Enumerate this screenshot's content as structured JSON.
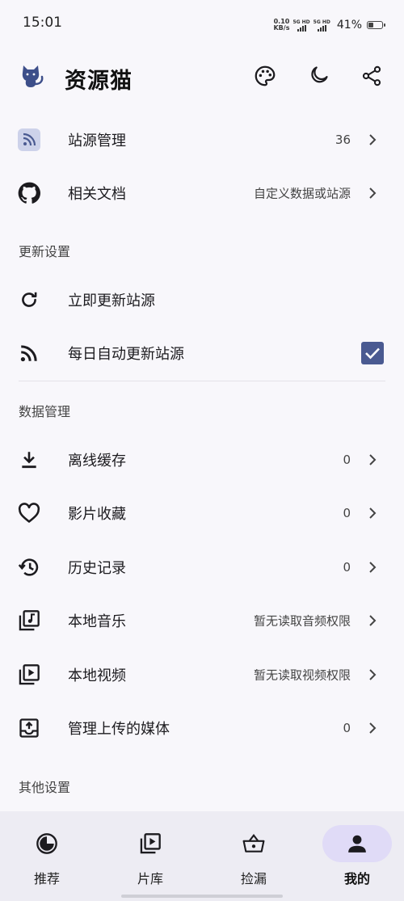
{
  "status_bar": {
    "time": "15:01",
    "net_speed_value": "0.10",
    "net_speed_unit": "KB/s",
    "sim1_label": "5G HD",
    "sim2_label": "5G HD",
    "battery_percent": "41%",
    "battery_level": 0.41
  },
  "app_bar": {
    "title": "资源猫",
    "actions": [
      "palette-icon",
      "dark-mode-icon",
      "share-icon"
    ]
  },
  "rows": {
    "source_manage": {
      "label": "站源管理",
      "value": "36",
      "icon": "rss-icon"
    },
    "docs": {
      "label": "相关文档",
      "value": "自定义数据或站源",
      "icon": "github-icon"
    }
  },
  "sections": {
    "update": {
      "header": "更新设置",
      "update_now": {
        "label": "立即更新站源",
        "icon": "refresh-icon"
      },
      "auto_update": {
        "label": "每日自动更新站源",
        "icon": "rss-icon",
        "checked": true
      }
    },
    "data": {
      "header": "数据管理",
      "offline_cache": {
        "label": "离线缓存",
        "value": "0",
        "icon": "download-icon"
      },
      "favorites": {
        "label": "影片收藏",
        "value": "0",
        "icon": "heart-icon"
      },
      "history": {
        "label": "历史记录",
        "value": "0",
        "icon": "history-icon"
      },
      "local_music": {
        "label": "本地音乐",
        "value": "暂无读取音频权限",
        "icon": "music-library-icon"
      },
      "local_video": {
        "label": "本地视频",
        "value": "暂无读取视频权限",
        "icon": "video-library-icon"
      },
      "uploaded_media": {
        "label": "管理上传的媒体",
        "value": "0",
        "icon": "upload-box-icon"
      }
    },
    "other": {
      "header": "其他设置"
    }
  },
  "bottom_nav": [
    {
      "label": "推荐",
      "icon": "recommend-icon",
      "active": false
    },
    {
      "label": "片库",
      "icon": "video-library-icon",
      "active": false
    },
    {
      "label": "捡漏",
      "icon": "basket-icon",
      "active": false
    },
    {
      "label": "我的",
      "icon": "person-icon",
      "active": true
    }
  ],
  "colors": {
    "background": "#f8f7fb",
    "accent": "#4a5a91",
    "nav_background": "#edecf3",
    "nav_active_pill": "#e0dbf7"
  }
}
